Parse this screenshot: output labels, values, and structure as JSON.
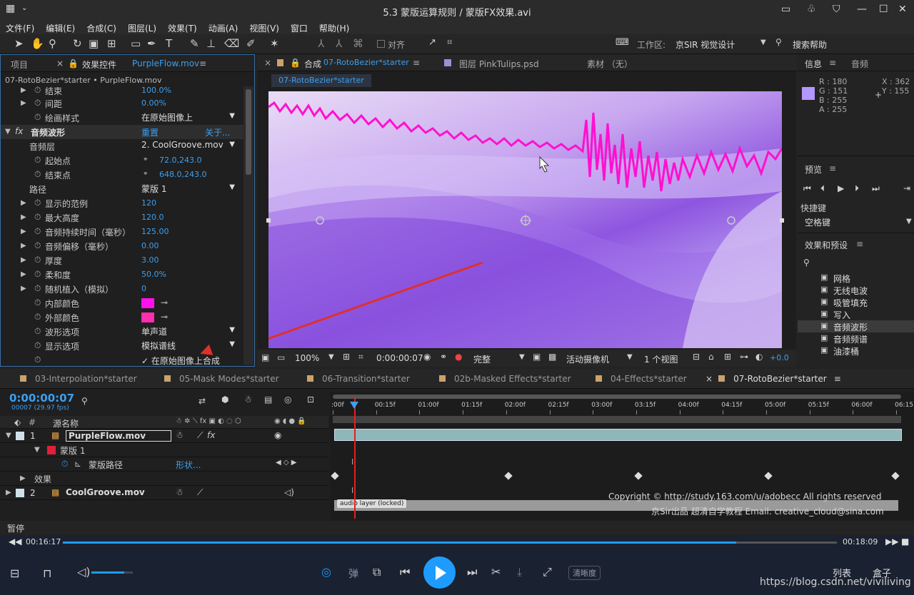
{
  "window": {
    "title": "5.3 蒙版运算规则 / 蒙版FX效果.avi"
  },
  "menu": [
    "文件(F)",
    "编辑(E)",
    "合成(C)",
    "图层(L)",
    "效果(T)",
    "动画(A)",
    "视图(V)",
    "窗口",
    "帮助(H)"
  ],
  "toolbar": {
    "align": "对齐",
    "workspace_label": "工作区:",
    "workspace": "京SIR 视觉设计",
    "search_help": "搜索帮助"
  },
  "left_panel": {
    "tab_project": "项目",
    "tab_effects": "效果控件",
    "tab_effects_file": "PurpleFlow.mov",
    "breadcrumb": "07-RotoBezier*starter • PurpleFlow.mov",
    "effect_name": "音频波形",
    "reset": "重置",
    "about": "关于...",
    "rows": [
      {
        "label": "结束",
        "value": "100.0%"
      },
      {
        "label": "间距",
        "value": "0.00%"
      },
      {
        "label": "绘画样式",
        "dropdown": "在原始图像上"
      },
      {
        "label": "音频层",
        "dropdown": "2. CoolGroove.mov"
      },
      {
        "label": "起始点",
        "value": "72.0,243.0"
      },
      {
        "label": "结束点",
        "value": "648.0,243.0"
      },
      {
        "label": "路径",
        "dropdown": "蒙版 1"
      },
      {
        "label": "显示的范例",
        "value": "120"
      },
      {
        "label": "最大高度",
        "value": "120.0"
      },
      {
        "label": "音频持续时间（毫秒）",
        "value": "125.00"
      },
      {
        "label": "音频偏移（毫秒）",
        "value": "0.00"
      },
      {
        "label": "厚度",
        "value": "3.00"
      },
      {
        "label": "柔和度",
        "value": "50.0%"
      },
      {
        "label": "随机植入（模拟）",
        "value": "0"
      },
      {
        "label": "内部颜色",
        "color": "#ff10ee"
      },
      {
        "label": "外部颜色",
        "color": "#ff2db0"
      },
      {
        "label": "波形选项",
        "dropdown": "单声道"
      },
      {
        "label": "显示选项",
        "dropdown": "模拟谱线"
      },
      {
        "label": "",
        "check": "✓ 在原始图像上合成"
      }
    ]
  },
  "comp_panel": {
    "tab_comp_label": "合成",
    "tab_comp": "07-RotoBezier*starter",
    "tab_layer": "图层 PinkTulips.psd",
    "tab_footage": "素材 （无）",
    "sub_tab": "07-RotoBezier*starter",
    "zoom": "100%",
    "timecode": "0:00:00:07",
    "resolution": "完整",
    "camera": "活动摄像机",
    "views": "1 个视图",
    "exposure": "+0.0"
  },
  "right_panel": {
    "info_tab": "信息",
    "audio_tab": "音频",
    "r": "R : 180",
    "g": "G : 151",
    "b": "B : 255",
    "a": "A : 255",
    "x": "X : 362",
    "y": "Y : 155",
    "swatch": "#b497ff",
    "preview_tab": "预览",
    "shortcut_label": "快捷键",
    "shortcut": "空格键",
    "effects_tab": "效果和预设",
    "effects": [
      "网格",
      "无线电波",
      "吸管填充",
      "写入",
      "音频波形",
      "音频频谱",
      "油漆桶"
    ]
  },
  "timeline": {
    "tabs": [
      "03-Interpolation*starter",
      "05-Mask Modes*starter",
      "06-Transition*starter",
      "02b-Masked Effects*starter",
      "04-Effects*starter",
      "07-RotoBezier*starter"
    ],
    "timecode": "0:00:00:07",
    "frames": "00007 (29.97 fps)",
    "col_name": "源名称",
    "ruler": [
      ":00f",
      "00:15f",
      "01:00f",
      "01:15f",
      "02:00f",
      "02:15f",
      "03:00f",
      "03:15f",
      "04:00f",
      "04:15f",
      "05:00f",
      "05:15f",
      "06:00f",
      "06:15"
    ],
    "layers": [
      {
        "num": "1",
        "name": "PurpleFlow.mov"
      },
      {
        "num": "",
        "name": "蒙版 1"
      },
      {
        "num": "",
        "name": "蒙版路径",
        "value": "形状..."
      },
      {
        "num": "",
        "name": "效果"
      },
      {
        "num": "2",
        "name": "CoolGroove.mov"
      }
    ],
    "audio_locked": "audio layer (locked)",
    "copyright1": "Copyright © http://study.163.com/u/adobecc All rights reserved",
    "copyright2": "京Sir出品 超清自学教程 Email: creative_cloud@sina.com"
  },
  "player": {
    "status": "暂停",
    "elapsed": "00:16:17",
    "total": "00:18:09",
    "progress": 0.87,
    "volume": 0.8,
    "bullet": "弹",
    "quality": "清晰度",
    "list": "列表",
    "box": "盒子",
    "watermark": "https://blog.csdn.net/viviliving"
  }
}
